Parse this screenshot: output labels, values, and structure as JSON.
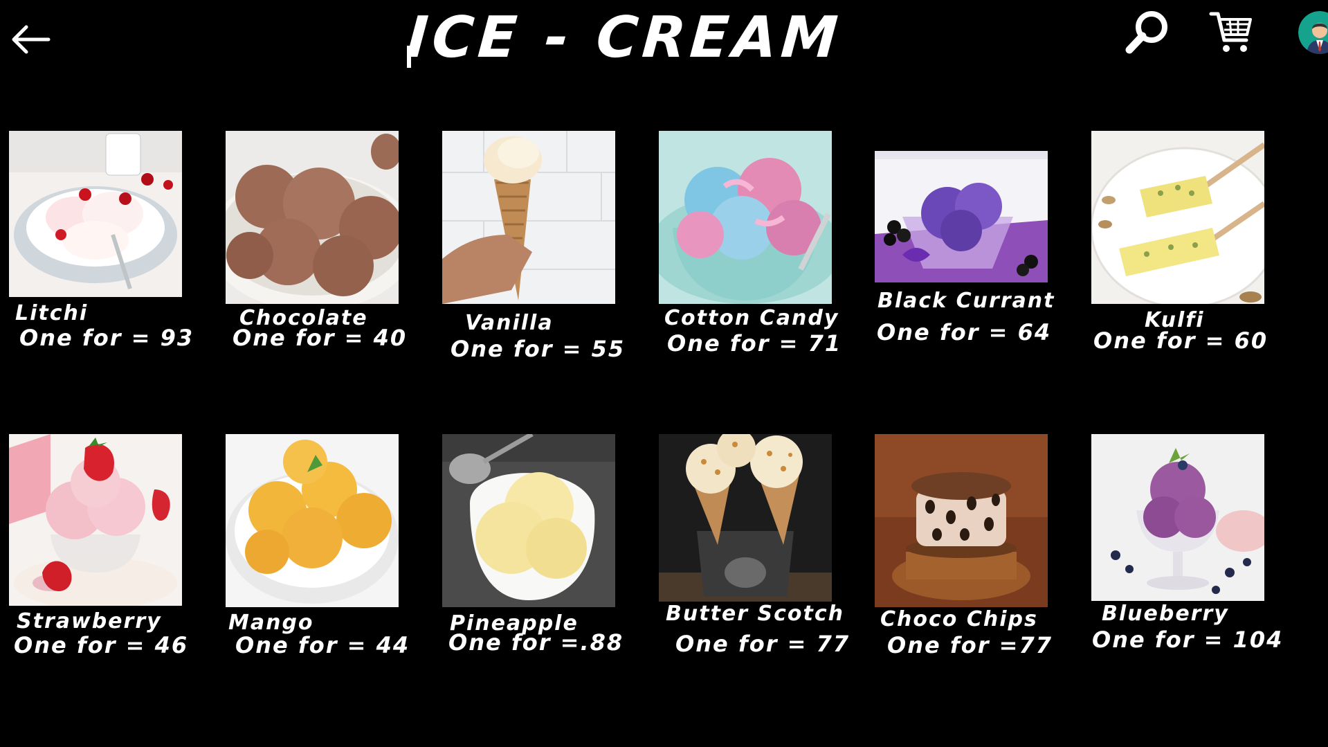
{
  "header": {
    "title": "ICE - CREAM",
    "back_icon": "arrow-left-icon",
    "search_icon": "search-icon",
    "cart_icon": "cart-icon",
    "avatar_icon": "avatar"
  },
  "products": [
    {
      "name": "Litchi",
      "price": "One for = 93"
    },
    {
      "name": "Chocolate",
      "price": "One for = 40"
    },
    {
      "name": "Vanilla",
      "price": "One for = 55"
    },
    {
      "name": "Cotton Candy",
      "price": "One for = 71"
    },
    {
      "name": "Black Currant",
      "price": "One for = 64"
    },
    {
      "name": "Kulfi",
      "price": "One for = 60"
    },
    {
      "name": "Strawberry",
      "price": "One for = 46"
    },
    {
      "name": "Mango",
      "price": "One for = 44"
    },
    {
      "name": "Pineapple",
      "price": "One for =.88"
    },
    {
      "name": "Butter Scotch",
      "price": "One for = 77"
    },
    {
      "name": "Choco Chips",
      "price": "One for =77"
    },
    {
      "name": "Blueberry",
      "price": "One for = 104"
    }
  ]
}
